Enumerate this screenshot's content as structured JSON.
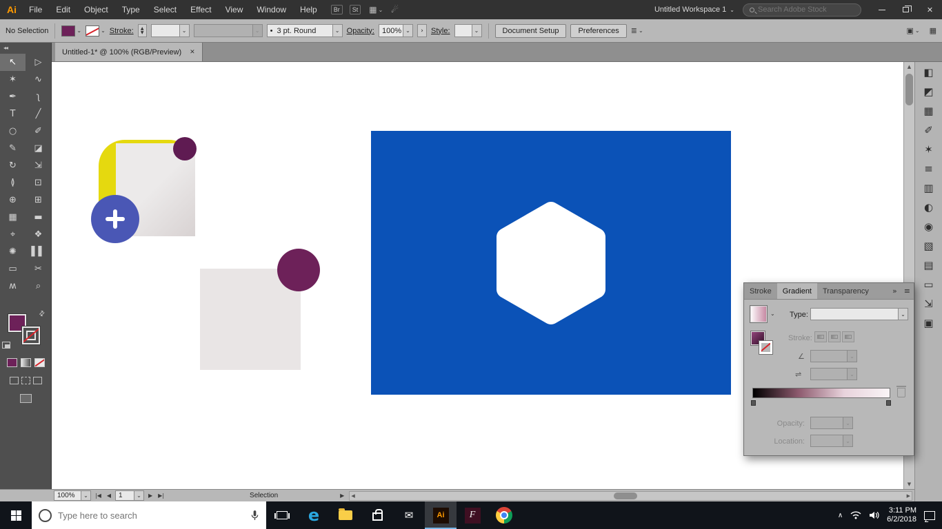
{
  "active_tool": "selection",
  "fill_color": "#6d2159",
  "ui": {
    "caret": "⌄"
  },
  "app_bar": {
    "logo": "Ai",
    "menus": [
      "File",
      "Edit",
      "Object",
      "Type",
      "Select",
      "Effect",
      "View",
      "Window",
      "Help"
    ],
    "bridge": "Br",
    "stock": "St",
    "arrange_icon": "▦",
    "gpu_icon": "☄",
    "workspace": "Untitled Workspace 1",
    "search_placeholder": "Search Adobe Stock"
  },
  "window_controls": {
    "close": "✕"
  },
  "control_bar": {
    "selection": "No Selection",
    "stroke_label": "Stroke:",
    "brush_bullet": "•",
    "brush": "3 pt. Round",
    "opacity_label": "Opacity:",
    "opacity_value": "100%",
    "chevron": "›",
    "style_label": "Style:",
    "document_setup": "Document Setup",
    "preferences": "Preferences",
    "options_icon": "≣",
    "panel_icon": "▣",
    "grid_icon": "▦"
  },
  "document_tab": {
    "title": "Untitled-1* @ 100% (RGB/Preview)",
    "close": "✕"
  },
  "toolbar": {
    "collapse": "◂◂",
    "swap": "⇄"
  },
  "tools": [
    {
      "id": "selection",
      "glyph": "↖"
    },
    {
      "id": "direct-selection",
      "glyph": "▷"
    },
    {
      "id": "magic-wand",
      "glyph": "✶"
    },
    {
      "id": "lasso",
      "glyph": "∿"
    },
    {
      "id": "pen",
      "glyph": "✒"
    },
    {
      "id": "curvature",
      "glyph": "ʅ"
    },
    {
      "id": "type",
      "glyph": "T"
    },
    {
      "id": "line-segment",
      "glyph": "╱"
    },
    {
      "id": "ellipse",
      "glyph": "○"
    },
    {
      "id": "paintbrush",
      "glyph": "✐"
    },
    {
      "id": "pencil",
      "glyph": "✎"
    },
    {
      "id": "eraser",
      "glyph": "◪"
    },
    {
      "id": "rotate",
      "glyph": "↻"
    },
    {
      "id": "scale",
      "glyph": "⇲"
    },
    {
      "id": "width",
      "glyph": "≬"
    },
    {
      "id": "free-transform",
      "glyph": "⊡"
    },
    {
      "id": "shape-builder",
      "glyph": "⊕"
    },
    {
      "id": "perspective-grid",
      "glyph": "⊞"
    },
    {
      "id": "mesh",
      "glyph": "▦"
    },
    {
      "id": "gradient",
      "glyph": "▬"
    },
    {
      "id": "eyedropper",
      "glyph": "⌖"
    },
    {
      "id": "blend",
      "glyph": "❖"
    },
    {
      "id": "symbol-sprayer",
      "glyph": "✺"
    },
    {
      "id": "column-graph",
      "glyph": "▌▌"
    },
    {
      "id": "artboard",
      "glyph": "▭"
    },
    {
      "id": "slice",
      "glyph": "✂"
    },
    {
      "id": "hand",
      "glyph": "ʍ"
    },
    {
      "id": "zoom",
      "glyph": "⌕"
    }
  ],
  "dock_icons": [
    {
      "id": "color",
      "glyph": "◧"
    },
    {
      "id": "color-guide",
      "glyph": "◩"
    },
    {
      "id": "swatches",
      "glyph": "▦"
    },
    {
      "id": "brushes",
      "glyph": "✐"
    },
    {
      "id": "symbols",
      "glyph": "✶"
    },
    {
      "id": "stroke",
      "glyph": "≡"
    },
    {
      "id": "gradient",
      "glyph": "▥"
    },
    {
      "id": "transparency",
      "glyph": "◐"
    },
    {
      "id": "appearance",
      "glyph": "◉"
    },
    {
      "id": "graphic-styles",
      "glyph": "▧"
    },
    {
      "id": "layers",
      "glyph": "▤"
    },
    {
      "id": "artboards",
      "glyph": "▭"
    },
    {
      "id": "asset-export",
      "glyph": "⇲"
    },
    {
      "id": "libraries",
      "glyph": "▣"
    }
  ],
  "gradient_panel": {
    "tabs": [
      "Stroke",
      "Gradient",
      "Transparency"
    ],
    "overflow": "»",
    "menu": "≡",
    "type_label": "Type:",
    "stroke_label": "Stroke:",
    "angle_icon": "∠",
    "reverse_icon": "⇌",
    "opacity_label": "Opacity:",
    "location_label": "Location:",
    "swatch_stops": [
      "#ffffff",
      "#c4849f"
    ],
    "slider_stops": [
      "#000000",
      "#8d5a6e",
      "#e8d3dc",
      "#f9f4f6"
    ]
  },
  "status_bar": {
    "zoom": "100%",
    "first": "|◀",
    "prev": "◀",
    "artboard": "1",
    "next": "▶",
    "last": "▶|",
    "message": "Selection",
    "expand": "▶",
    "scroll_left": "◀",
    "scroll_right": "▶",
    "up": "▲",
    "down": "▼"
  },
  "canvas_colors": {
    "blue_rect": "#0b52b7",
    "hexagon": "#ffffff",
    "gray_square": "#e9e5e5",
    "circle_purple": "#6d2159",
    "logo_yellow": "#e5d90f",
    "logo_yellow_dark": "#cfc30c",
    "logo_indigo": "#4a57b5",
    "logo_purple": "#5f1b52",
    "logo_gray_light": "#eceaea",
    "logo_gray_dark": "#d8d2d2"
  },
  "taskbar": {
    "search_placeholder": "Type here to search",
    "edge_letter": "e",
    "mail_glyph": "✉",
    "ai_label": "Ai",
    "fuse_label": "F",
    "tray_chevron": "∧",
    "time": "3:11 PM",
    "date": "6/2/2018"
  }
}
